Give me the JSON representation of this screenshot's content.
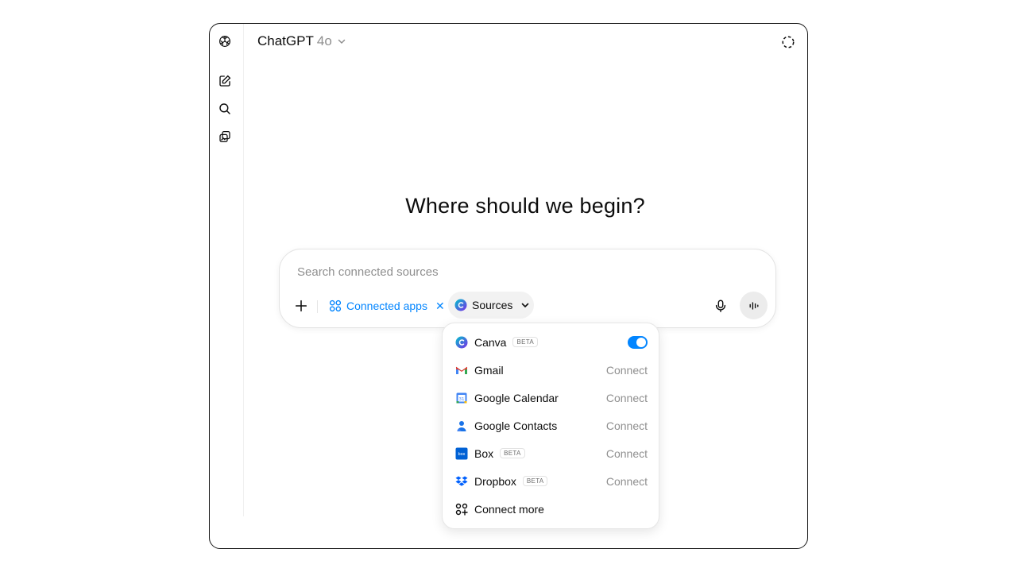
{
  "header": {
    "model_name": "ChatGPT",
    "model_version": "4o"
  },
  "main": {
    "headline": "Where should we begin?"
  },
  "composer": {
    "placeholder": "Search connected sources",
    "connected_apps_label": "Connected apps",
    "close_glyph": "✕",
    "sources_label": "Sources"
  },
  "sources_menu": {
    "beta_label": "BETA",
    "items": [
      {
        "label": "Canva",
        "beta": true,
        "action": "",
        "enabled": true
      },
      {
        "label": "Gmail",
        "beta": false,
        "action": "Connect"
      },
      {
        "label": "Google Calendar",
        "beta": false,
        "action": "Connect"
      },
      {
        "label": "Google Contacts",
        "beta": false,
        "action": "Connect"
      },
      {
        "label": "Box",
        "beta": true,
        "action": "Connect"
      },
      {
        "label": "Dropbox",
        "beta": true,
        "action": "Connect"
      },
      {
        "label": "Connect more",
        "beta": false,
        "action": ""
      }
    ]
  },
  "colors": {
    "accent": "#0285ff",
    "text": "#0d0d0d",
    "muted": "#8f8f8f"
  },
  "icons": {
    "logo": "openai-logo-icon",
    "new_chat": "edit-icon",
    "search": "search-icon",
    "library": "library-icon",
    "temporary_chat": "dashed-circle-icon"
  }
}
